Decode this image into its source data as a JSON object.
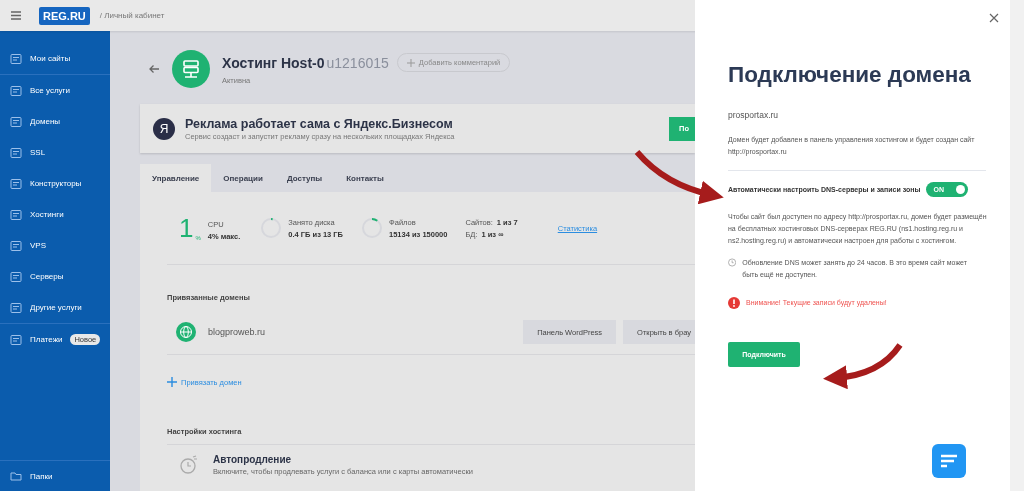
{
  "topbar": {
    "logo": "REG.RU",
    "breadcrumb": "/ Личный кабинет"
  },
  "sidebar": {
    "items": [
      {
        "label": "Мои сайты"
      },
      {
        "label": "Все услуги"
      },
      {
        "label": "Домены"
      },
      {
        "label": "SSL"
      },
      {
        "label": "Конструкторы"
      },
      {
        "label": "Хостинги"
      },
      {
        "label": "VPS"
      },
      {
        "label": "Серверы"
      },
      {
        "label": "Другие услуги"
      },
      {
        "label": "Платежи",
        "badge": "Новое"
      }
    ],
    "bottom_item": {
      "label": "Папки"
    }
  },
  "service": {
    "title": "Хостинг Host-0",
    "login": "u1216015",
    "status": "Активна",
    "comment_button": "Добавить комментарий"
  },
  "banner": {
    "logo": "Я",
    "title": "Реклама работает сама с Яндекс.Бизнесом",
    "subtitle": "Сервис создаст и запустит рекламу сразу на нескольких площадках Яндекса",
    "button": "По"
  },
  "tabs": [
    {
      "label": "Управление",
      "selected": true
    },
    {
      "label": "Операции",
      "selected": false
    },
    {
      "label": "Доступы",
      "selected": false
    },
    {
      "label": "Контакты",
      "selected": false
    }
  ],
  "stats": {
    "cpu": {
      "value": "1",
      "unit": "%",
      "label": "CPU",
      "detail": "4% макс."
    },
    "meters": [
      {
        "label": "Занято диска",
        "reading": "0.4 ГБ из 13 ГБ",
        "level": 0.03
      },
      {
        "label": "Файлов",
        "reading": "15134 из 150000",
        "level": 0.1
      }
    ],
    "counts": [
      {
        "label": "Сайтов:",
        "value": "1 из 7"
      },
      {
        "label": "БД:",
        "value": "1 из ∞"
      }
    ],
    "link": "Статистика"
  },
  "linked_domains": {
    "heading": "Привязанные домены",
    "domains": [
      {
        "name": "blogproweb.ru",
        "buttons": [
          "Панель WordPress",
          "Открыть в брау"
        ]
      }
    ],
    "add_link": "Привязать домен"
  },
  "hosting_settings": {
    "heading": "Настройки хостинга",
    "items": [
      {
        "title": "Автопродление",
        "description": "Включите, чтобы продлевать услуги с баланса или с карты автоматически"
      }
    ]
  },
  "drawer": {
    "title": "Подключение домена",
    "domain": "prosportax.ru",
    "description": "Домен будет добавлен в панель управления хостингом и будет создан сайт http://prosportax.ru",
    "auto_dns": {
      "label": "Автоматически настроить DNS-серверы и записи зоны",
      "toggle_text": "ON",
      "on": true
    },
    "dns_info": "Чтобы сайт был доступен по адресу http://prosportax.ru, домен будет размещён на бесплатных хостинговых DNS-серверах REG.RU (ns1.hosting.reg.ru и ns2.hosting.reg.ru) и автоматически настроен для работы с хостингом.",
    "notice": "Обновление DNS может занять до 24 часов. В это время сайт может быть ещё не доступен.",
    "warning": "Внимание! Текущие записи будут удалены!",
    "submit": "Подключить"
  }
}
